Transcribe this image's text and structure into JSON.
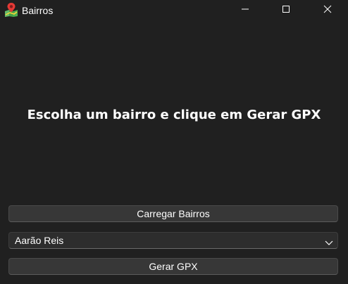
{
  "window": {
    "title": "Bairros"
  },
  "main": {
    "headline": "Escolha um bairro e clique em Gerar GPX",
    "load_button_label": "Carregar Bairros",
    "neighborhood_select": {
      "selected": "Aarão Reis"
    },
    "generate_button_label": "Gerar GPX"
  },
  "icons": {
    "app": "map-pin-icon",
    "minimize": "minimize-icon",
    "maximize": "maximize-icon",
    "close": "close-icon",
    "dropdown": "chevron-down-icon"
  },
  "colors": {
    "background": "#202020",
    "button": "#373737",
    "combo": "#2d2d2d",
    "text": "#ffffff"
  }
}
